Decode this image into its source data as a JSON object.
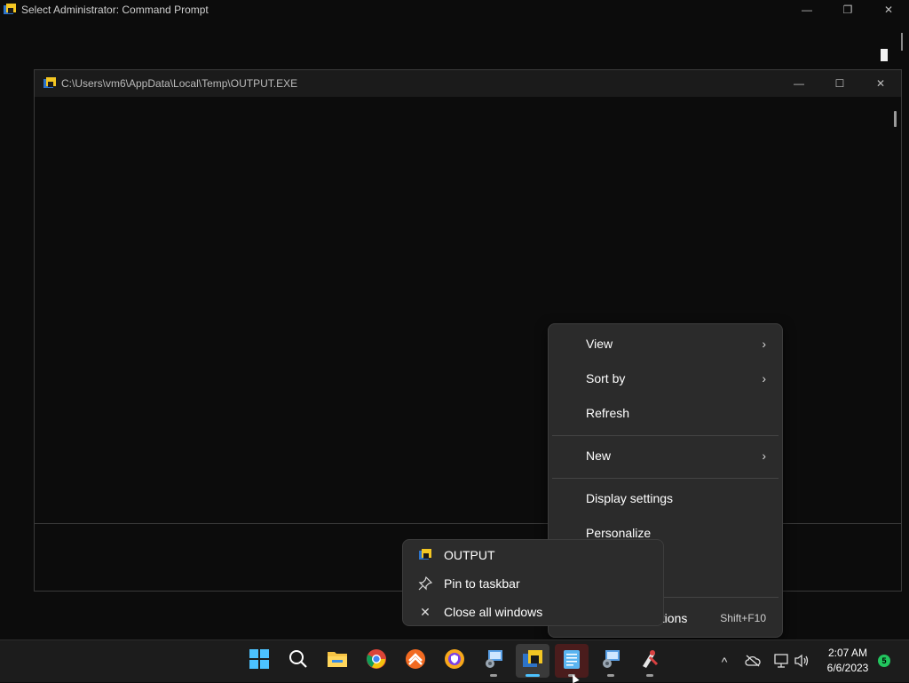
{
  "cmd_window": {
    "title": "Select Administrator:  Command Prompt",
    "controls": {
      "minimize": "—",
      "restore": "❐",
      "close": "✕"
    }
  },
  "output_window": {
    "title": "C:\\Users\\vm6\\AppData\\Local\\Temp\\OUTPUT.EXE",
    "controls": {
      "minimize": "—",
      "maximize": "☐",
      "close": "✕"
    }
  },
  "context_menu": {
    "items": [
      {
        "label": "View",
        "has_submenu": true
      },
      {
        "label": "Sort by",
        "has_submenu": true
      },
      {
        "label": "Refresh"
      },
      {
        "label": "New",
        "has_submenu": true
      },
      {
        "label": "Display settings"
      },
      {
        "label": "Personalize"
      },
      {
        "label": "otions",
        "shortcut": "Shift+F10"
      }
    ],
    "chevron": "›"
  },
  "jump_list": {
    "items": [
      {
        "label": "OUTPUT",
        "icon": "app-icon"
      },
      {
        "label": "Pin to taskbar",
        "icon": "pin-icon"
      },
      {
        "label": "Close all windows",
        "icon": "close-icon"
      }
    ]
  },
  "taskbar": {
    "apps": [
      "start",
      "search",
      "file-explorer",
      "chrome",
      "app-orange",
      "app-shield",
      "control-panel",
      "command-prompt-output",
      "notepad",
      "network-config",
      "app-tool"
    ],
    "tray": {
      "chevron": "^",
      "time": "2:07 AM",
      "date": "6/6/2023",
      "badge": "5"
    }
  },
  "colors": {
    "accent": "#4cc2ff",
    "menu_bg": "#2b2b2b",
    "badge": "#22c55e"
  }
}
